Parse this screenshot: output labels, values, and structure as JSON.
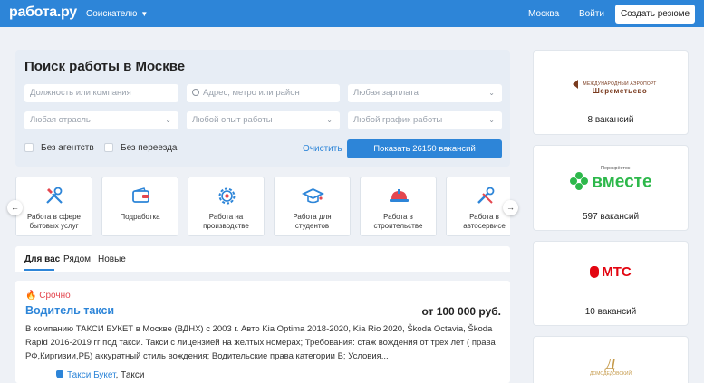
{
  "header": {
    "logo": "работа.ру",
    "role": "Соискателю",
    "city": "Москва",
    "login": "Войти",
    "create_resume": "Создать резюме"
  },
  "search": {
    "title": "Поиск работы в Москве",
    "position_placeholder": "Должность или компания",
    "address_placeholder": "Адрес, метро или район",
    "salary_select": "Любая зарплата",
    "industry_select": "Любая отрасль",
    "experience_select": "Любой опыт работы",
    "schedule_select": "Любой график работы",
    "no_agencies": "Без агентств",
    "no_relocation": "Без переезда",
    "clear": "Очистить",
    "show_button": "Показать 26150 вакансий"
  },
  "categories": [
    {
      "label": "Работа в сфере бытовых услуг",
      "icon": "tools-icon"
    },
    {
      "label": "Подработка",
      "icon": "wallet-icon"
    },
    {
      "label": "Работа на производстве",
      "icon": "gear-icon"
    },
    {
      "label": "Работа для студентов",
      "icon": "graduation-cap-icon"
    },
    {
      "label": "Работа в строительстве",
      "icon": "hard-hat-icon"
    },
    {
      "label": "Работа в автосервисе",
      "icon": "wrench-icon"
    }
  ],
  "feed_tabs": [
    {
      "label": "Для вас",
      "active": true
    },
    {
      "label": "Рядом",
      "active": false
    },
    {
      "label": "Новые",
      "active": false
    }
  ],
  "vacancy": {
    "badge": "Срочно",
    "title": "Водитель такси",
    "salary": "от 100 000 руб.",
    "description": "В компанию ТАКСИ БУКЕТ в Москве (ВДНХ) с 2003 г. Авто Kia Optima 2018-2020, Kia Rio 2020, Škoda Octavia, Škoda Rapid 2016-2019 гг под такси. Такси с лицензией на желтых номерах; Требования: стаж вождения от трех лет ( права РФ,Киргизии,РБ) аккуратный стиль вождения; Водительские права категории В; Условия...",
    "company": "Такси Букет",
    "company_industry": "Такси"
  },
  "employers": [
    {
      "name": "Шереметьево",
      "caption": "МЕЖДУНАРОДНЫЙ АЭРОПОРТ",
      "vacancies": "8 вакансий"
    },
    {
      "name": "вместе",
      "caption": "Перекрёсток",
      "vacancies": "597 вакансий"
    },
    {
      "name": "МТС",
      "caption": "",
      "vacancies": "10 вакансий"
    },
    {
      "name": "Д",
      "caption": "ДОМОДЕДОВСКИЙ",
      "vacancies": ""
    }
  ],
  "colors": {
    "brand_blue": "#2d85d8",
    "urgent_red": "#e4474f",
    "mts_red": "#e30611",
    "vmeste_green": "#2db84b",
    "sheremetyevo_brown": "#7a3b1f",
    "domodedovo_gold": "#c59a4a"
  }
}
